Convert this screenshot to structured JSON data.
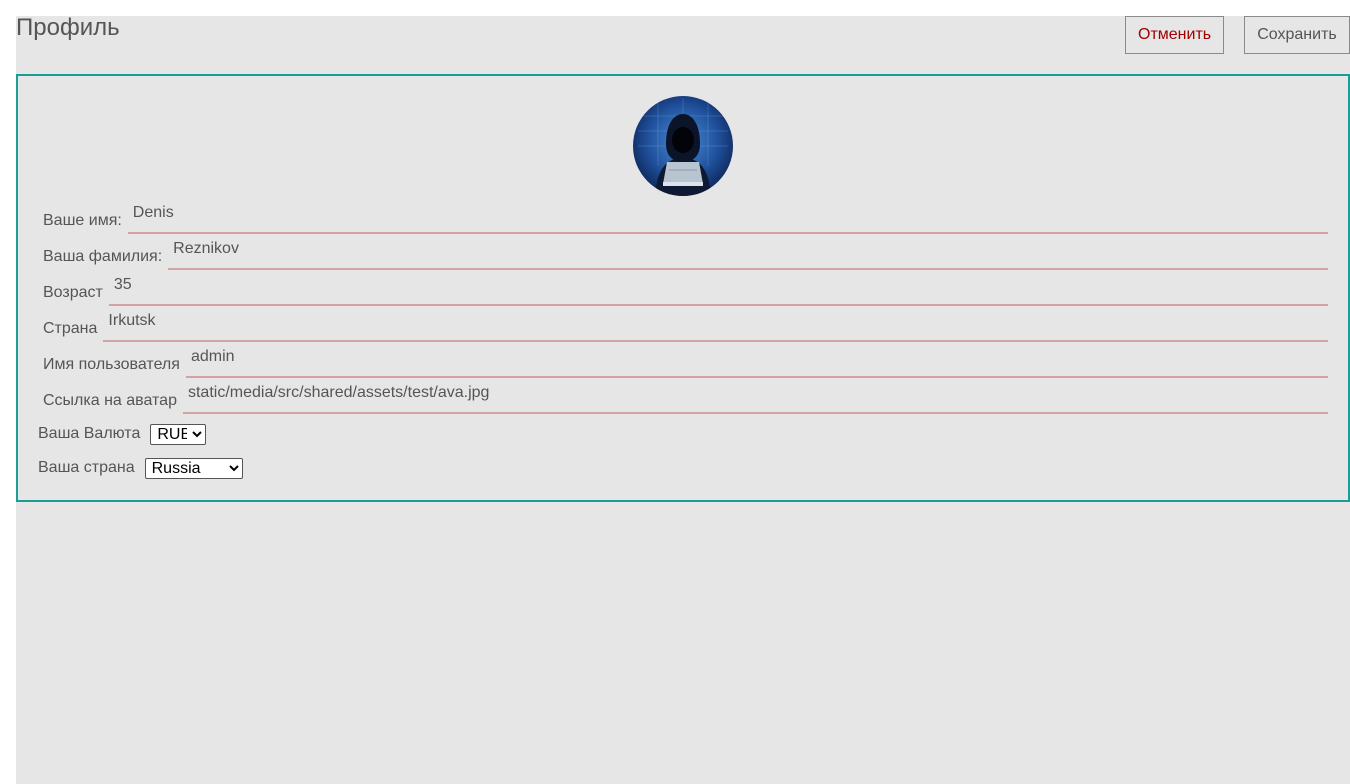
{
  "header": {
    "title": "Профиль",
    "cancel_label": "Отменить",
    "save_label": "Сохранить"
  },
  "profile": {
    "avatar_icon": "hacker-avatar",
    "fields": [
      {
        "label": "Ваше имя:",
        "value": "Denis"
      },
      {
        "label": "Ваша фамилия:",
        "value": "Reznikov"
      },
      {
        "label": "Возраст",
        "value": "35"
      },
      {
        "label": "Страна",
        "value": "Irkutsk"
      },
      {
        "label": "Имя пользователя",
        "value": "admin"
      },
      {
        "label": "Ссылка на аватар",
        "value": "static/media/src/shared/assets/test/ava.jpg"
      }
    ],
    "currency": {
      "label": "Ваша Валюта",
      "selected": "RUB"
    },
    "country": {
      "label": "Ваша страна",
      "selected": "Russia"
    }
  },
  "colors": {
    "accent_border": "#1b9e96",
    "cancel_text": "#a00000",
    "input_underline": "#d2a3a3",
    "background": "#e6e6e6"
  }
}
